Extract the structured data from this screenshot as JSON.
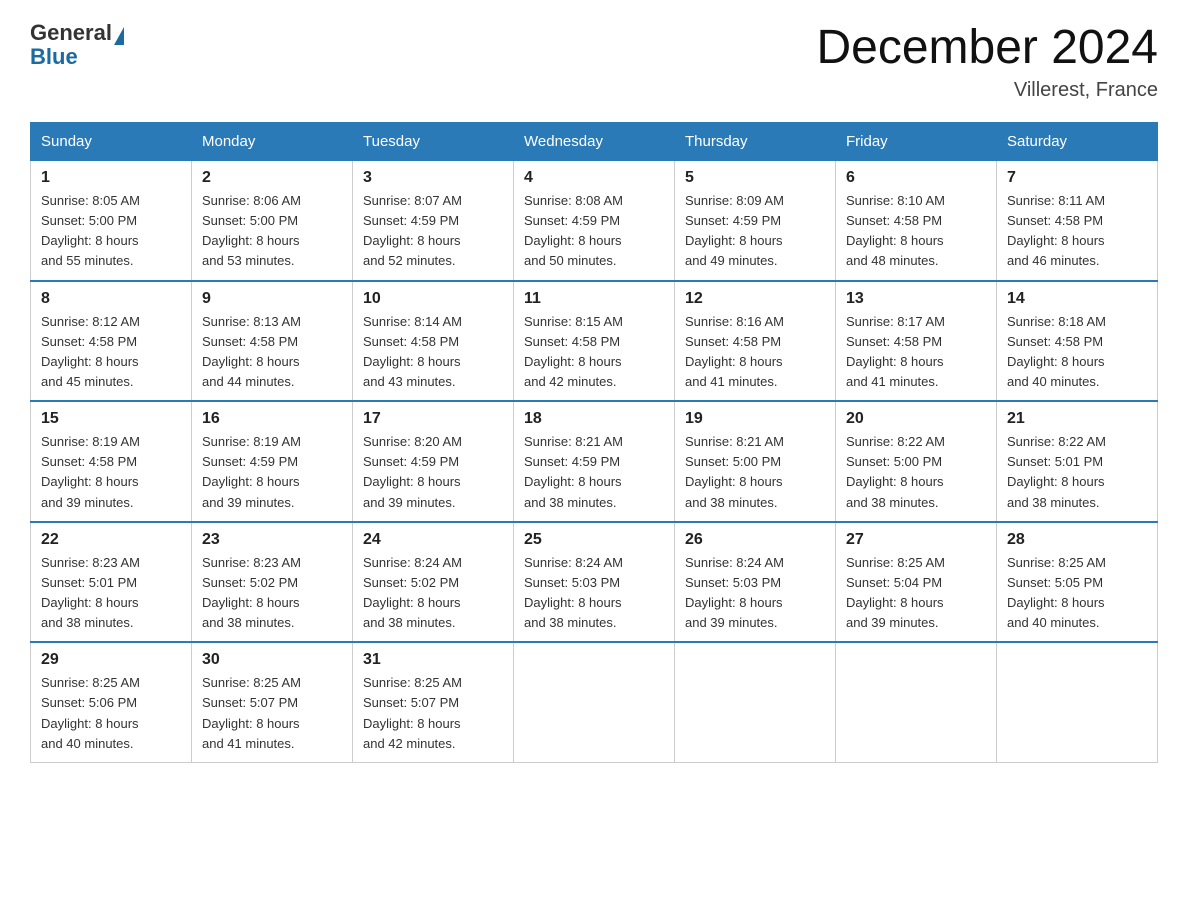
{
  "header": {
    "logo_general": "General",
    "logo_blue": "Blue",
    "title": "December 2024",
    "location": "Villerest, France"
  },
  "days_of_week": [
    "Sunday",
    "Monday",
    "Tuesday",
    "Wednesday",
    "Thursday",
    "Friday",
    "Saturday"
  ],
  "weeks": [
    [
      {
        "day": "1",
        "sunrise": "8:05 AM",
        "sunset": "5:00 PM",
        "daylight": "8 hours and 55 minutes."
      },
      {
        "day": "2",
        "sunrise": "8:06 AM",
        "sunset": "5:00 PM",
        "daylight": "8 hours and 53 minutes."
      },
      {
        "day": "3",
        "sunrise": "8:07 AM",
        "sunset": "4:59 PM",
        "daylight": "8 hours and 52 minutes."
      },
      {
        "day": "4",
        "sunrise": "8:08 AM",
        "sunset": "4:59 PM",
        "daylight": "8 hours and 50 minutes."
      },
      {
        "day": "5",
        "sunrise": "8:09 AM",
        "sunset": "4:59 PM",
        "daylight": "8 hours and 49 minutes."
      },
      {
        "day": "6",
        "sunrise": "8:10 AM",
        "sunset": "4:58 PM",
        "daylight": "8 hours and 48 minutes."
      },
      {
        "day": "7",
        "sunrise": "8:11 AM",
        "sunset": "4:58 PM",
        "daylight": "8 hours and 46 minutes."
      }
    ],
    [
      {
        "day": "8",
        "sunrise": "8:12 AM",
        "sunset": "4:58 PM",
        "daylight": "8 hours and 45 minutes."
      },
      {
        "day": "9",
        "sunrise": "8:13 AM",
        "sunset": "4:58 PM",
        "daylight": "8 hours and 44 minutes."
      },
      {
        "day": "10",
        "sunrise": "8:14 AM",
        "sunset": "4:58 PM",
        "daylight": "8 hours and 43 minutes."
      },
      {
        "day": "11",
        "sunrise": "8:15 AM",
        "sunset": "4:58 PM",
        "daylight": "8 hours and 42 minutes."
      },
      {
        "day": "12",
        "sunrise": "8:16 AM",
        "sunset": "4:58 PM",
        "daylight": "8 hours and 41 minutes."
      },
      {
        "day": "13",
        "sunrise": "8:17 AM",
        "sunset": "4:58 PM",
        "daylight": "8 hours and 41 minutes."
      },
      {
        "day": "14",
        "sunrise": "8:18 AM",
        "sunset": "4:58 PM",
        "daylight": "8 hours and 40 minutes."
      }
    ],
    [
      {
        "day": "15",
        "sunrise": "8:19 AM",
        "sunset": "4:58 PM",
        "daylight": "8 hours and 39 minutes."
      },
      {
        "day": "16",
        "sunrise": "8:19 AM",
        "sunset": "4:59 PM",
        "daylight": "8 hours and 39 minutes."
      },
      {
        "day": "17",
        "sunrise": "8:20 AM",
        "sunset": "4:59 PM",
        "daylight": "8 hours and 39 minutes."
      },
      {
        "day": "18",
        "sunrise": "8:21 AM",
        "sunset": "4:59 PM",
        "daylight": "8 hours and 38 minutes."
      },
      {
        "day": "19",
        "sunrise": "8:21 AM",
        "sunset": "5:00 PM",
        "daylight": "8 hours and 38 minutes."
      },
      {
        "day": "20",
        "sunrise": "8:22 AM",
        "sunset": "5:00 PM",
        "daylight": "8 hours and 38 minutes."
      },
      {
        "day": "21",
        "sunrise": "8:22 AM",
        "sunset": "5:01 PM",
        "daylight": "8 hours and 38 minutes."
      }
    ],
    [
      {
        "day": "22",
        "sunrise": "8:23 AM",
        "sunset": "5:01 PM",
        "daylight": "8 hours and 38 minutes."
      },
      {
        "day": "23",
        "sunrise": "8:23 AM",
        "sunset": "5:02 PM",
        "daylight": "8 hours and 38 minutes."
      },
      {
        "day": "24",
        "sunrise": "8:24 AM",
        "sunset": "5:02 PM",
        "daylight": "8 hours and 38 minutes."
      },
      {
        "day": "25",
        "sunrise": "8:24 AM",
        "sunset": "5:03 PM",
        "daylight": "8 hours and 38 minutes."
      },
      {
        "day": "26",
        "sunrise": "8:24 AM",
        "sunset": "5:03 PM",
        "daylight": "8 hours and 39 minutes."
      },
      {
        "day": "27",
        "sunrise": "8:25 AM",
        "sunset": "5:04 PM",
        "daylight": "8 hours and 39 minutes."
      },
      {
        "day": "28",
        "sunrise": "8:25 AM",
        "sunset": "5:05 PM",
        "daylight": "8 hours and 40 minutes."
      }
    ],
    [
      {
        "day": "29",
        "sunrise": "8:25 AM",
        "sunset": "5:06 PM",
        "daylight": "8 hours and 40 minutes."
      },
      {
        "day": "30",
        "sunrise": "8:25 AM",
        "sunset": "5:07 PM",
        "daylight": "8 hours and 41 minutes."
      },
      {
        "day": "31",
        "sunrise": "8:25 AM",
        "sunset": "5:07 PM",
        "daylight": "8 hours and 42 minutes."
      },
      null,
      null,
      null,
      null
    ]
  ],
  "labels": {
    "sunrise": "Sunrise:",
    "sunset": "Sunset:",
    "daylight": "Daylight:"
  }
}
